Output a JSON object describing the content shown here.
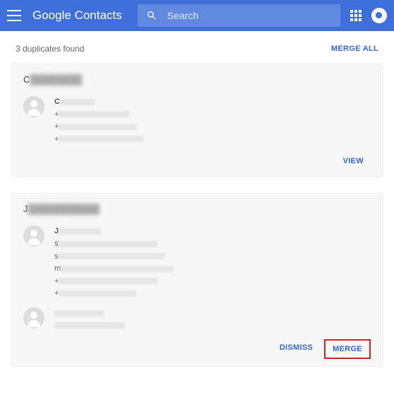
{
  "header": {
    "app_name_bold": "Google",
    "app_name_rest": "Contacts",
    "search_placeholder": "Search"
  },
  "top": {
    "dup_text": "3 duplicates found",
    "merge_all": "MERGE ALL"
  },
  "card1": {
    "title_visible": "C",
    "name_visible": "C",
    "line_prefix": "+",
    "view": "VIEW"
  },
  "card2": {
    "title_visible": "J",
    "name_visible": "J",
    "line_s": "s",
    "line_m": "m",
    "line_plus": "+",
    "dismiss": "DISMISS",
    "merge": "MERGE"
  }
}
